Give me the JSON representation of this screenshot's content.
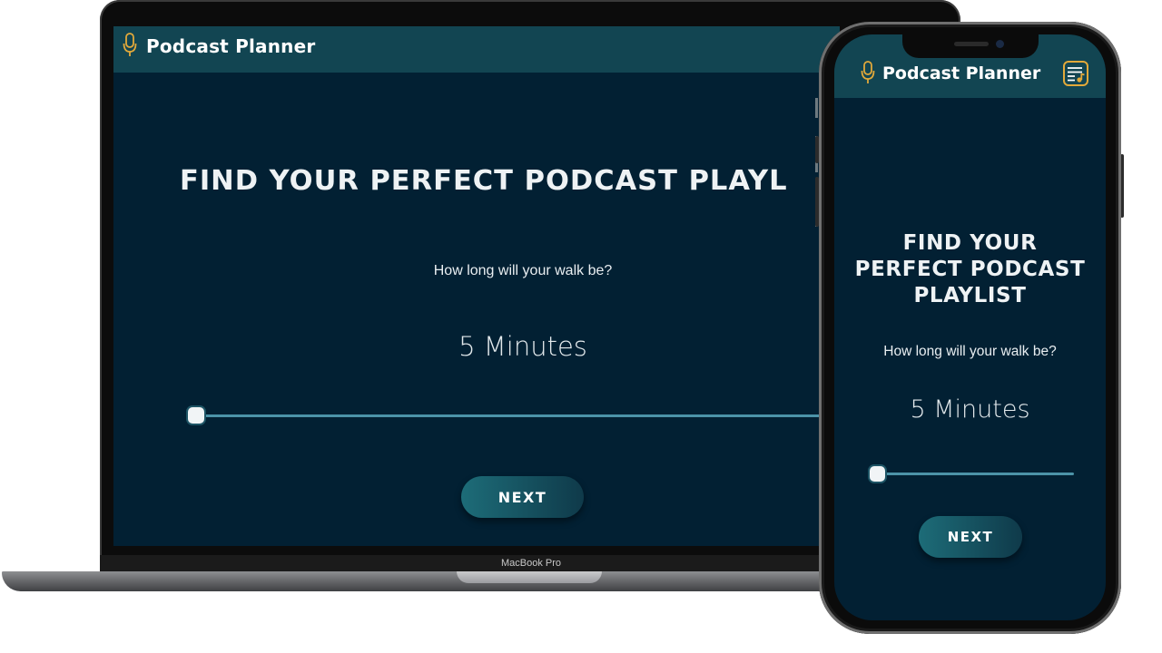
{
  "laptop": {
    "app": {
      "brand": "Podcast Planner",
      "title": "FIND YOUR PERFECT PODCAST PLAYL",
      "question": "How long will your walk be?",
      "duration_label": "5 Minutes",
      "slider_value_fraction": 0,
      "next_label": "NEXT"
    },
    "device_label": "MacBook Pro"
  },
  "phone": {
    "app": {
      "brand": "Podcast Planner",
      "title_lines": [
        "FIND YOUR",
        "PERFECT PODCAST",
        "PLAYLIST"
      ],
      "question": "How long will your walk be?",
      "duration_label": "5 Minutes",
      "slider_value_fraction": 0,
      "next_label": "NEXT",
      "menu_icon": "playlist-music-icon"
    }
  },
  "colors": {
    "background": "#022033",
    "header": "#124552",
    "accent_icon": "#e2a93a",
    "slider_track": "#4c93a8",
    "button_gradient_start": "#1d6c78",
    "button_gradient_end": "#0f3a4a"
  }
}
